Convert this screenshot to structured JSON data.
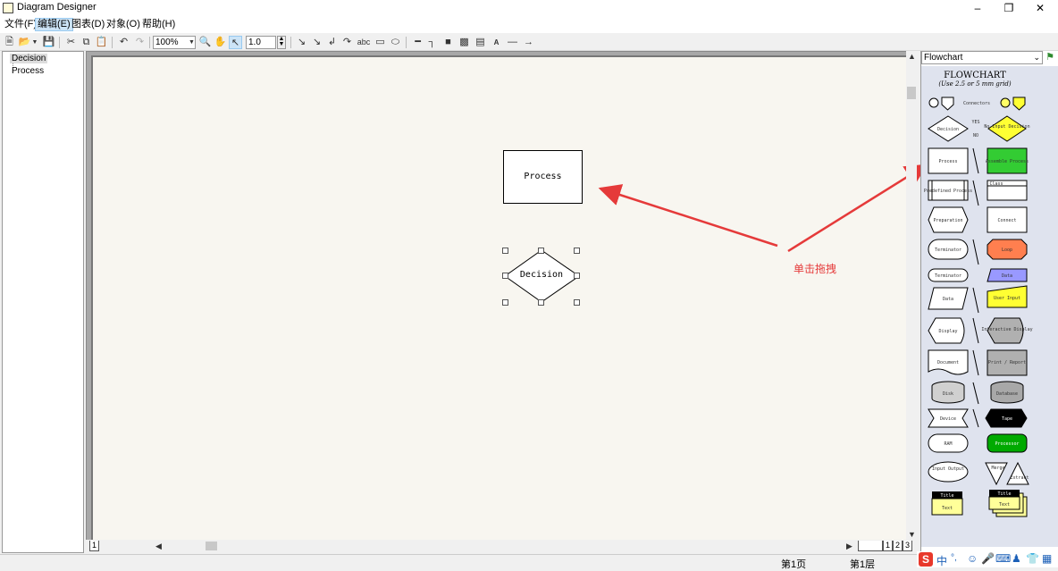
{
  "window": {
    "title": "Diagram Designer"
  },
  "menu": {
    "items": [
      "文件(F)",
      "编辑(E)",
      "图表(D)",
      "对象(O)",
      "帮助(H)"
    ]
  },
  "toolbar": {
    "zoom": "100%",
    "line_width": "1.0",
    "text_tool": "abc"
  },
  "tree": {
    "items": [
      "Decision",
      "Process"
    ]
  },
  "canvas": {
    "process_label": "Process",
    "decision_label": "Decision",
    "annotation": "单击拖拽"
  },
  "page_tabs": [
    "1",
    "1",
    "2",
    "3"
  ],
  "library": {
    "selected": "Flowchart",
    "title": "FLOWCHART",
    "subtitle": "(Use 2.5 or 5 mm grid)",
    "shapes": {
      "connectors": "Connectors",
      "decision": "Decision",
      "yes": "YES",
      "no": "NO",
      "no_input_decision": "No-Input Decision",
      "process": "Process",
      "assemble_process": "Assemble Process",
      "predefined_process": "Predefined Process",
      "class": "Class",
      "preparation": "Preparation",
      "connect": "Connect",
      "terminator": "Terminator",
      "loop": "Loop",
      "terminator2": "Terminator",
      "data_blue": "Data",
      "data": "Data",
      "user_input": "User Input",
      "display": "Display",
      "interactive_display": "Interactive Display",
      "document": "Document",
      "print_report": "Print / Report",
      "disk": "Disk",
      "database": "Database",
      "device": "Device",
      "tape": "Tape",
      "ram": "RAM",
      "processor": "Processor",
      "input_output": "Input Output",
      "merge": "Merge",
      "extract": "Extract",
      "title1": "Title",
      "text1": "Text",
      "title2": "Title",
      "text2": "Text"
    }
  },
  "status": {
    "page": "第1页",
    "layer": "第1层"
  },
  "ime": {
    "logo": "S",
    "lang": "中",
    "punct": "°,"
  },
  "colors": {
    "accent_red": "#e53a3a",
    "lib_bg": "#dfe3ee",
    "page_bg": "#f8f6f0"
  }
}
